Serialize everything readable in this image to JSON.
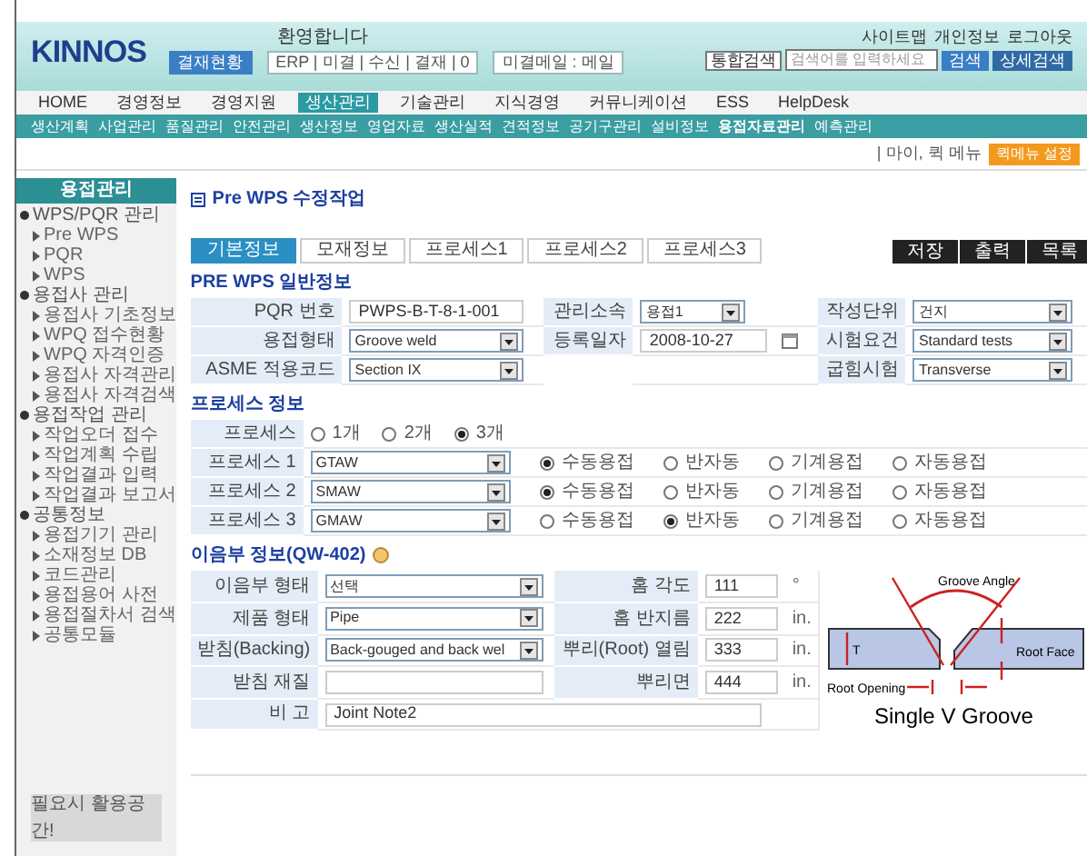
{
  "header": {
    "logo": "KINNOS",
    "greeting": "환영합니다",
    "chips": [
      "결재현황",
      "ERP | 미결 | 수신 | 결재 | 0",
      "미결메일 : 메일"
    ],
    "links": [
      "사이트맵",
      "개인정보",
      "로그아웃"
    ],
    "search": {
      "scope": "통합검색",
      "placeholder": "검색어를 입력하세요",
      "button": "검색",
      "extra": "상세검색"
    }
  },
  "nav": [
    {
      "label": "HOME",
      "selected": false
    },
    {
      "label": "경영정보",
      "selected": false
    },
    {
      "label": "경영지원",
      "selected": false
    },
    {
      "label": "생산관리",
      "selected": true
    },
    {
      "label": "기술관리",
      "selected": false
    },
    {
      "label": "지식경영",
      "selected": false
    },
    {
      "label": "커뮤니케이션",
      "selected": false
    },
    {
      "label": "ESS",
      "selected": false
    },
    {
      "label": "HelpDesk",
      "selected": false
    }
  ],
  "subnav": [
    {
      "label": "생산계획",
      "selected": false
    },
    {
      "label": "사업관리",
      "selected": false
    },
    {
      "label": "품질관리",
      "selected": false
    },
    {
      "label": "안전관리",
      "selected": false
    },
    {
      "label": "생산정보",
      "selected": false
    },
    {
      "label": "영업자료",
      "selected": false
    },
    {
      "label": "생산실적",
      "selected": false
    },
    {
      "label": "견적정보",
      "selected": false
    },
    {
      "label": "공기구관리",
      "selected": false
    },
    {
      "label": "설비정보",
      "selected": false
    },
    {
      "label": "용접자료관리",
      "selected": true
    },
    {
      "label": "예측관리",
      "selected": false
    }
  ],
  "quickbar": {
    "text": "| 마이, 퀵 메뉴",
    "button": "퀵메뉴 설정"
  },
  "sidebar": {
    "title": "용접관리",
    "groups": [
      {
        "label": "WPS/PQR 관리",
        "children": [
          "Pre WPS",
          "PQR",
          "WPS"
        ]
      },
      {
        "label": "용접사 관리",
        "children": [
          "용접사 기초정보",
          "WPQ 접수현황",
          "WPQ 자격인증",
          "용접사 자격관리",
          "용접사 자격검색"
        ]
      },
      {
        "label": "용접작업 관리",
        "children": [
          "작업오더 접수",
          "작업계획 수립",
          "작업결과 입력",
          "작업결과 보고서"
        ]
      },
      {
        "label": "공통정보",
        "children": [
          "용접기기 관리",
          "소재정보 DB",
          "코드관리",
          "용접용어 사전",
          "용접절차서 검색",
          "공통모듈"
        ]
      }
    ],
    "footer": "필요시 활용공간!"
  },
  "page_title": "Pre WPS 수정작업",
  "tabs": [
    {
      "label": "기본정보",
      "selected": true
    },
    {
      "label": "모재정보",
      "selected": false
    },
    {
      "label": "프로세스1",
      "selected": false
    },
    {
      "label": "프로세스2",
      "selected": false
    },
    {
      "label": "프로세스3",
      "selected": false
    }
  ],
  "actions": [
    "저장",
    "출력",
    "목록"
  ],
  "general": {
    "title": "PRE WPS 일반정보",
    "rows": [
      [
        {
          "label": "PQR 번호",
          "kind": "text",
          "value": "PWPS-B-T-8-1-001"
        },
        {
          "label": "관리소속",
          "kind": "select",
          "value": "용접1"
        },
        {
          "label": "작성단위",
          "kind": "select",
          "value": "건지"
        }
      ],
      [
        {
          "label": "용접형태",
          "kind": "select",
          "value": "Groove weld"
        },
        {
          "label": "등록일자",
          "kind": "date",
          "value": "2008-10-27"
        },
        {
          "label": "시험요건",
          "kind": "select",
          "value": "Standard tests"
        }
      ],
      [
        {
          "label": "ASME 적용코드",
          "kind": "select",
          "value": "Section IX"
        },
        {
          "kind": "empty"
        },
        {
          "label": "굽힘시험",
          "kind": "select",
          "value": "Transverse"
        }
      ]
    ]
  },
  "process": {
    "title": "프로세스 정보",
    "count_label": "프로세스",
    "counts": [
      {
        "label": "1개",
        "selected": false
      },
      {
        "label": "2개",
        "selected": false
      },
      {
        "label": "3개",
        "selected": true
      }
    ],
    "rows": [
      {
        "label": "프로세스 1",
        "value": "GTAW",
        "modes": [
          {
            "label": "수동용접",
            "selected": true
          },
          {
            "label": "반자동",
            "selected": false
          },
          {
            "label": "기계용접",
            "selected": false
          },
          {
            "label": "자동용접",
            "selected": false
          }
        ]
      },
      {
        "label": "프로세스 2",
        "value": "SMAW",
        "modes": [
          {
            "label": "수동용접",
            "selected": true
          },
          {
            "label": "반자동",
            "selected": false
          },
          {
            "label": "기계용접",
            "selected": false
          },
          {
            "label": "자동용접",
            "selected": false
          }
        ]
      },
      {
        "label": "프로세스 3",
        "value": "GMAW",
        "modes": [
          {
            "label": "수동용접",
            "selected": false
          },
          {
            "label": "반자동",
            "selected": true
          },
          {
            "label": "기계용접",
            "selected": false
          },
          {
            "label": "자동용접",
            "selected": false
          }
        ]
      }
    ]
  },
  "joint": {
    "title": "이음부 정보(QW-402)",
    "rows": [
      [
        {
          "label": "이음부 형태",
          "kind": "select",
          "value": "선택"
        },
        {
          "label": "홈 각도",
          "kind": "text",
          "value": "111",
          "unit": "°"
        }
      ],
      [
        {
          "label": "제품 형태",
          "kind": "select",
          "value": "Pipe"
        },
        {
          "label": "홈 반지름",
          "kind": "text",
          "value": "222",
          "unit": "in."
        }
      ],
      [
        {
          "label": "받침(Backing)",
          "kind": "select",
          "value": "Back-gouged and back wel"
        },
        {
          "label": "뿌리(Root) 열림",
          "kind": "text",
          "value": "333",
          "unit": "in."
        }
      ],
      [
        {
          "label": "받침 재질",
          "kind": "text"
        },
        {
          "label": "뿌리면",
          "kind": "text",
          "value": "444",
          "unit": "in."
        }
      ]
    ],
    "note": {
      "label": "비 고",
      "value": "Joint Note2"
    },
    "diagram": {
      "angle": "Groove Angle",
      "face": "Root Face",
      "opening": "Root Opening",
      "thickness": "T",
      "caption": "Single V Groove"
    }
  }
}
